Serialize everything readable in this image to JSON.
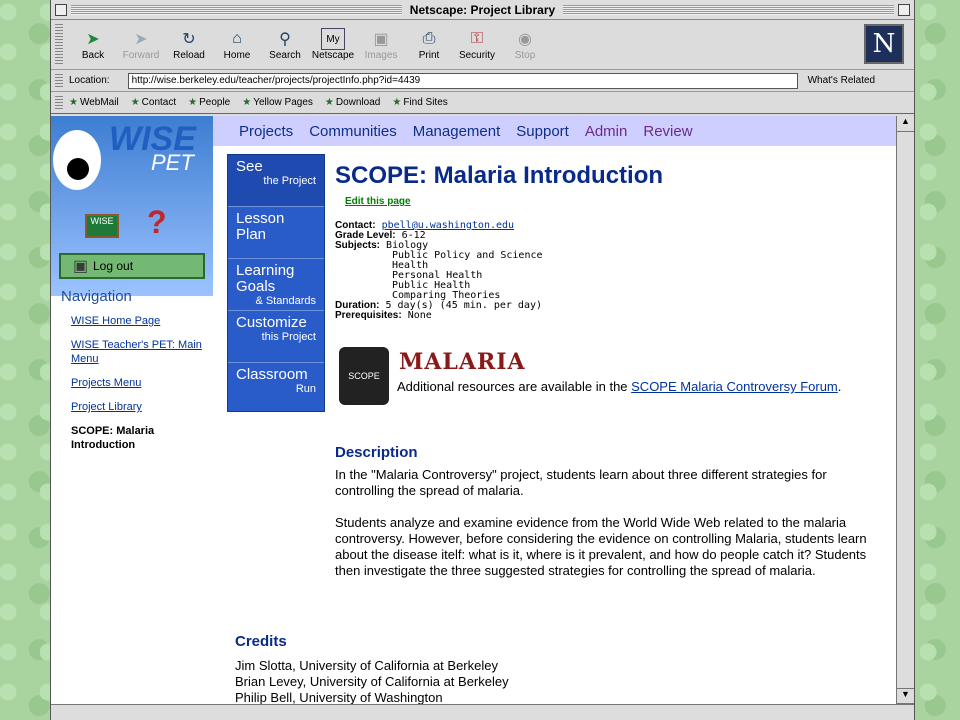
{
  "window": {
    "title": "Netscape: Project Library"
  },
  "toolbar": {
    "buttons": [
      {
        "label": "Back",
        "icon": "back-arrow-icon",
        "enabled": true
      },
      {
        "label": "Forward",
        "icon": "forward-arrow-icon",
        "enabled": false
      },
      {
        "label": "Reload",
        "icon": "reload-icon",
        "enabled": true
      },
      {
        "label": "Home",
        "icon": "home-icon",
        "enabled": true
      },
      {
        "label": "Search",
        "icon": "search-icon",
        "enabled": true
      },
      {
        "label": "Netscape",
        "icon": "netscape-icon",
        "enabled": true
      },
      {
        "label": "Images",
        "icon": "images-icon",
        "enabled": false
      },
      {
        "label": "Print",
        "icon": "print-icon",
        "enabled": true
      },
      {
        "label": "Security",
        "icon": "lock-icon",
        "enabled": true
      },
      {
        "label": "Stop",
        "icon": "stop-icon",
        "enabled": false
      }
    ]
  },
  "location": {
    "label": "Location:",
    "url": "http://wise.berkeley.edu/teacher/projects/projectInfo.php?id=4439",
    "related": "What's Related"
  },
  "personal_toolbar": [
    "WebMail",
    "Contact",
    "People",
    "Yellow Pages",
    "Download",
    "Find Sites"
  ],
  "logo": {
    "wise": "WISE",
    "pet": "PET",
    "board": "WISE",
    "logout": "Log out"
  },
  "navigation": {
    "title": "Navigation",
    "links": [
      "WISE Home Page",
      "WISE Teacher's PET: Main Menu",
      "Projects Menu",
      "Project Library"
    ],
    "current": "SCOPE: Malaria Introduction"
  },
  "topnav": [
    {
      "label": "Projects",
      "color": "#0c2f8a"
    },
    {
      "label": "Communities",
      "color": "#0c2f8a"
    },
    {
      "label": "Management",
      "color": "#0c2f8a"
    },
    {
      "label": "Support",
      "color": "#0c2f8a"
    },
    {
      "label": "Admin",
      "color": "#6c2b8a"
    },
    {
      "label": "Review",
      "color": "#6c2b8a"
    }
  ],
  "sidemenu": [
    {
      "big": "See",
      "small": "the Project"
    },
    {
      "big": "Lesson Plan",
      "small": ""
    },
    {
      "big": "Learning Goals",
      "small": "& Standards"
    },
    {
      "big": "Customize",
      "small": "this Project"
    },
    {
      "big": "Classroom",
      "small": "Run"
    }
  ],
  "project": {
    "title": "SCOPE: Malaria Introduction",
    "edit_link": "Edit this page",
    "contact_label": "Contact:",
    "contact": "pbell@u.washington.edu",
    "grade_label": "Grade Level:",
    "grade": "6-12",
    "subjects_label": "Subjects:",
    "subjects": [
      "Biology",
      "Public Policy and Science",
      "Health",
      "Personal Health",
      "Public Health",
      "Comparing Theories"
    ],
    "duration_label": "Duration:",
    "duration": "5 day(s) (45 min. per day)",
    "prereq_label": "Prerequisites:",
    "prereq": "None"
  },
  "resources": {
    "scope_logo": "SCOPE",
    "malaria_logo": "MALARIA",
    "text_before": "Additional resources are available in the ",
    "link": "SCOPE Malaria Controversy Forum",
    "text_after": "."
  },
  "description": {
    "heading": "Description",
    "p1": "In the \"Malaria Controversy\" project, students learn about three different strategies for controlling the spread of malaria.",
    "p2": "Students analyze and examine evidence from the World Wide Web related to the malaria controversy. However, before considering the evidence on controlling Malaria, students learn about the disease itelf: what is it, where is it prevalent, and how do people catch it? Students then investigate the three suggested strategies for controlling the spread of malaria."
  },
  "credits": {
    "heading": "Credits",
    "names": [
      "Jim Slotta, University of California at Berkeley",
      "Brian Levey, University of California at Berkeley",
      "Philip Bell, University of Washington"
    ]
  }
}
